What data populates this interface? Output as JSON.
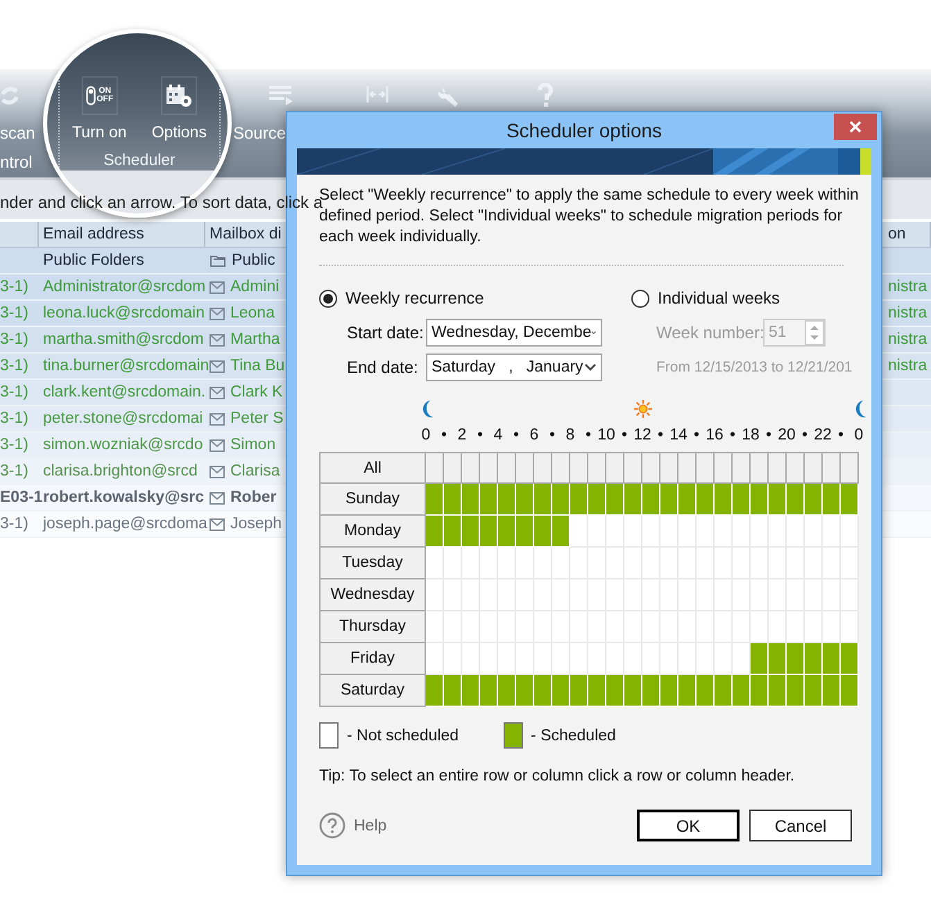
{
  "ribbon": {
    "left_button": "scan",
    "left_group": "ntrol",
    "right_button": "Source"
  },
  "magnifier": {
    "buttons": [
      {
        "label": "Turn on",
        "kind": "toggle",
        "icon_text": [
          "ON",
          "OFF"
        ]
      },
      {
        "label": "Options",
        "kind": "options"
      }
    ],
    "group": "Scheduler"
  },
  "info_bar": "nder and click an arrow. To sort data, click a",
  "table": {
    "columns": [
      "Email address",
      "Mailbox di",
      "on"
    ],
    "rows": [
      {
        "email": "Public Folders",
        "kind": "folder",
        "display": "Public",
        "bold": false
      },
      {
        "column_1": "3-1)",
        "email": "Administrator@srcdom",
        "kind": "mailbox",
        "display": "Admini",
        "column_4": "nistra",
        "bold": false
      },
      {
        "column_1": "3-1)",
        "email": "leona.luck@srcdomain",
        "kind": "mailbox",
        "display": "Leona",
        "column_4": "nistra",
        "bold": false
      },
      {
        "column_1": "3-1)",
        "email": "martha.smith@srcdom",
        "kind": "mailbox",
        "display": "Martha",
        "column_4": "nistra",
        "bold": false
      },
      {
        "column_1": "3-1)",
        "email": "tina.burner@srcdomain",
        "kind": "mailbox",
        "display": "Tina Bu",
        "column_4": "nistra",
        "bold": false
      },
      {
        "column_1": "3-1)",
        "email": "clark.kent@srcdomain.",
        "kind": "mailbox",
        "display": "Clark K",
        "bold": false
      },
      {
        "column_1": "3-1)",
        "email": "peter.stone@srcdomai",
        "kind": "mailbox",
        "display": "Peter S",
        "bold": false
      },
      {
        "column_1": "3-1)",
        "email": "simon.wozniak@srcdo",
        "kind": "mailbox",
        "display": "Simon",
        "bold": false
      },
      {
        "column_1": "3-1)",
        "email": "clarisa.brighton@srcd",
        "kind": "mailbox",
        "display": "Clarisa",
        "bold": false
      },
      {
        "column_1": "E03-1",
        "email": "robert.kowalsky@src",
        "kind": "mailbox",
        "display": "Rober",
        "bold": true
      },
      {
        "column_1": "3-1)",
        "email": "joseph.page@srcdoma",
        "kind": "mailbox",
        "display": "Joseph",
        "bold": false
      }
    ]
  },
  "dialog": {
    "title": "Scheduler options",
    "description": "Select \"Weekly recurrence\" to apply the same schedule to every week within defined period. Select \"Individual weeks\" to schedule migration periods for each week individually.",
    "modes": [
      {
        "label": "Weekly recurrence",
        "selected": true
      },
      {
        "label": "Individual weeks",
        "selected": false
      }
    ],
    "start_date": {
      "label": "Start date:",
      "value": "Wednesday, Decembe"
    },
    "end_date": {
      "label": "End date:",
      "value": "Saturday   ,   January"
    },
    "week_number": {
      "label": "Week number:",
      "value": "51",
      "disabled": true
    },
    "range": "From 12/15/2013 to 12/21/201",
    "schedule": {
      "all_label": "All",
      "hour_labels": [
        "0",
        "•",
        "2",
        "•",
        "4",
        "•",
        "6",
        "•",
        "8",
        "•",
        "10",
        "•",
        "12",
        "•",
        "14",
        "•",
        "16",
        "•",
        "18",
        "•",
        "20",
        "•",
        "22",
        "•",
        "0"
      ],
      "days": [
        {
          "name": "Sunday",
          "hours": [
            true,
            true,
            true,
            true,
            true,
            true,
            true,
            true,
            true,
            true,
            true,
            true,
            true,
            true,
            true,
            true,
            true,
            true,
            true,
            true,
            true,
            true,
            true,
            true
          ]
        },
        {
          "name": "Monday",
          "hours": [
            true,
            true,
            true,
            true,
            true,
            true,
            true,
            true,
            false,
            false,
            false,
            false,
            false,
            false,
            false,
            false,
            false,
            false,
            false,
            false,
            false,
            false,
            false,
            false
          ]
        },
        {
          "name": "Tuesday",
          "hours": [
            false,
            false,
            false,
            false,
            false,
            false,
            false,
            false,
            false,
            false,
            false,
            false,
            false,
            false,
            false,
            false,
            false,
            false,
            false,
            false,
            false,
            false,
            false,
            false
          ]
        },
        {
          "name": "Wednesday",
          "hours": [
            false,
            false,
            false,
            false,
            false,
            false,
            false,
            false,
            false,
            false,
            false,
            false,
            false,
            false,
            false,
            false,
            false,
            false,
            false,
            false,
            false,
            false,
            false,
            false
          ]
        },
        {
          "name": "Thursday",
          "hours": [
            false,
            false,
            false,
            false,
            false,
            false,
            false,
            false,
            false,
            false,
            false,
            false,
            false,
            false,
            false,
            false,
            false,
            false,
            false,
            false,
            false,
            false,
            false,
            false
          ]
        },
        {
          "name": "Friday",
          "hours": [
            false,
            false,
            false,
            false,
            false,
            false,
            false,
            false,
            false,
            false,
            false,
            false,
            false,
            false,
            false,
            false,
            false,
            false,
            true,
            true,
            true,
            true,
            true,
            true
          ]
        },
        {
          "name": "Saturday",
          "hours": [
            true,
            true,
            true,
            true,
            true,
            true,
            true,
            true,
            true,
            true,
            true,
            true,
            true,
            true,
            true,
            true,
            true,
            true,
            true,
            true,
            true,
            true,
            true,
            true
          ]
        }
      ]
    },
    "legend": [
      {
        "label": "- Not scheduled",
        "scheduled": false
      },
      {
        "label": "- Scheduled",
        "scheduled": true
      }
    ],
    "tip": "Tip: To select an entire row or column click a row or column header.",
    "help": "Help",
    "buttons": [
      {
        "label": "OK",
        "default": true
      },
      {
        "label": "Cancel",
        "default": false
      }
    ]
  }
}
